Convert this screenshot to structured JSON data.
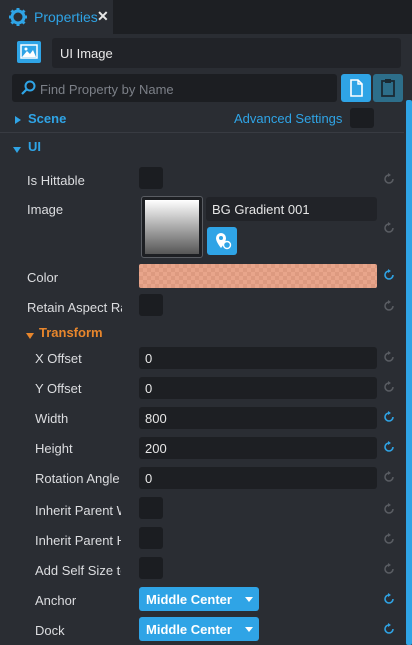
{
  "tab": {
    "title": "Properties",
    "close": "✕"
  },
  "object": {
    "name": "UI Image"
  },
  "search": {
    "placeholder": "Find Property by Name"
  },
  "sections": {
    "scene": "Scene",
    "advanced": "Advanced Settings",
    "ui": "UI",
    "transform": "Transform"
  },
  "properties": {
    "is_hittable": "Is Hittable",
    "image": "Image",
    "image_asset": "BG Gradient 001",
    "color": "Color",
    "color_value": "#e8a58b",
    "retain_aspect": "Retain Aspect Ra",
    "x_offset": {
      "label": "X Offset",
      "value": "0"
    },
    "y_offset": {
      "label": "Y Offset",
      "value": "0"
    },
    "width": {
      "label": "Width",
      "value": "800"
    },
    "height": {
      "label": "Height",
      "value": "200"
    },
    "rotation": {
      "label": "Rotation Angle",
      "value": "0"
    },
    "inherit_w": "Inherit Parent W",
    "inherit_h": "Inherit Parent H",
    "add_self": "Add Self Size to",
    "anchor": {
      "label": "Anchor",
      "value": "Middle Center"
    },
    "dock": {
      "label": "Dock",
      "value": "Middle Center"
    }
  },
  "colors": {
    "accent": "#2fa4e6",
    "transform_header": "#e8862c",
    "reset_modified": "#2fa4e6",
    "reset_default": "#5a5d63"
  },
  "icons": [
    "gear-icon",
    "close-icon",
    "ui-image-icon",
    "search-icon",
    "document-icon",
    "clipboard-icon",
    "reset-icon",
    "locate-asset-icon",
    "chevron-down-icon"
  ]
}
